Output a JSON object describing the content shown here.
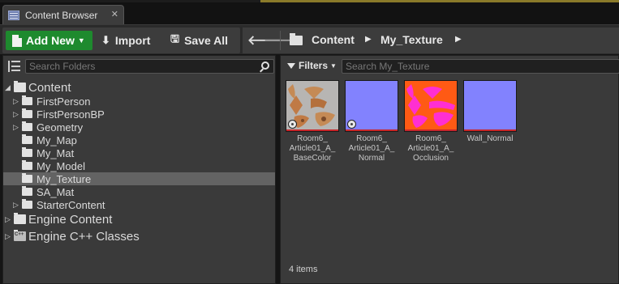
{
  "window": {
    "tab_label": "Content Browser",
    "tab_close": "✕"
  },
  "toolbar": {
    "add_new_label": "Add New",
    "import_label": "Import",
    "save_all_label": "Save All"
  },
  "breadcrumb": {
    "items": [
      "Content",
      "My_Texture"
    ]
  },
  "folders": {
    "search_placeholder": "Search Folders",
    "tree": [
      {
        "label": "Content",
        "expanded": true
      },
      {
        "label": "FirstPerson",
        "has_children": true
      },
      {
        "label": "FirstPersonBP",
        "has_children": true
      },
      {
        "label": "Geometry",
        "has_children": true
      },
      {
        "label": "My_Map",
        "has_children": false
      },
      {
        "label": "My_Mat",
        "has_children": false
      },
      {
        "label": "My_Model",
        "has_children": false
      },
      {
        "label": "My_Texture",
        "has_children": false,
        "selected": true
      },
      {
        "label": "SA_Mat",
        "has_children": false
      },
      {
        "label": "StarterContent",
        "has_children": true
      },
      {
        "label": "Engine Content",
        "has_children": true
      },
      {
        "label": "Engine C++ Classes",
        "has_children": true
      }
    ]
  },
  "assets": {
    "filters_label": "Filters",
    "search_placeholder": "Search My_Texture",
    "items": [
      {
        "name_lines": [
          "Room6_",
          "Article01_A_",
          "BaseColor"
        ],
        "thumb_color": "#b7b5b3",
        "modified": true
      },
      {
        "name_lines": [
          "Room6_",
          "Article01_A_",
          "Normal"
        ],
        "thumb_color": "#8282fe",
        "modified": true
      },
      {
        "name_lines": [
          "Room6_",
          "Article01_A_",
          "Occlusion"
        ],
        "thumb_color": "#ff5a14",
        "modified": false
      },
      {
        "name_lines": [
          "Wall_Normal"
        ],
        "thumb_color": "#8282fe",
        "modified": false
      }
    ],
    "count_label": "4 items"
  },
  "colors": {
    "accent_green": "#1e8a2e",
    "thumb_bar_red": "#c8262a",
    "selection": "#636363"
  }
}
